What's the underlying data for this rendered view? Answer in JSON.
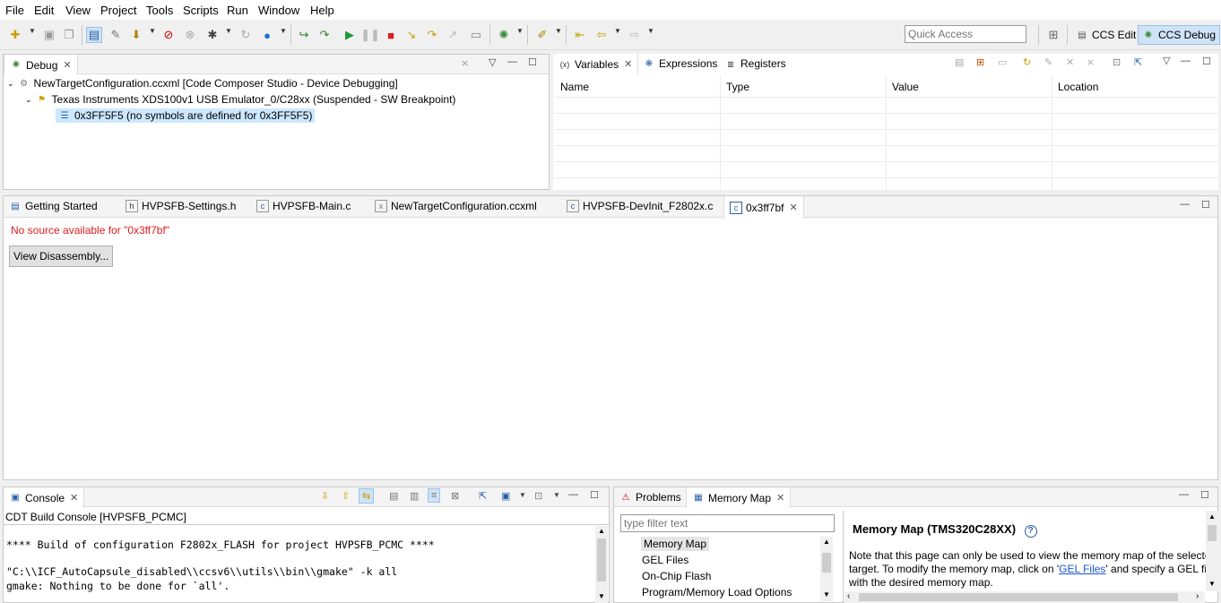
{
  "menu": [
    "File",
    "Edit",
    "View",
    "Project",
    "Tools",
    "Scripts",
    "Run",
    "Window",
    "Help"
  ],
  "toolbar": {
    "quick_access_placeholder": "Quick Access",
    "perspectives": [
      {
        "label": "CCS Edit",
        "active": false
      },
      {
        "label": "CCS Debug",
        "active": true
      }
    ]
  },
  "debug_view": {
    "tab_label": "Debug",
    "tree": [
      {
        "label": "NewTargetConfiguration.ccxml [Code Composer Studio - Device Debugging]",
        "level": 0
      },
      {
        "label": "Texas Instruments XDS100v1 USB Emulator_0/C28xx (Suspended - SW Breakpoint)",
        "level": 1
      },
      {
        "label": "0x3FF5F5  (no symbols are defined for 0x3FF5F5)",
        "level": 2,
        "selected": true
      }
    ]
  },
  "variables_view": {
    "tabs": [
      "Variables",
      "Expressions",
      "Registers"
    ],
    "columns": [
      "Name",
      "Type",
      "Value",
      "Location"
    ]
  },
  "editor": {
    "tabs": [
      {
        "label": "Getting Started"
      },
      {
        "label": "HVPSFB-Settings.h"
      },
      {
        "label": "HVPSFB-Main.c"
      },
      {
        "label": "NewTargetConfiguration.ccxml"
      },
      {
        "label": "HVPSFB-DevInit_F2802x.c"
      },
      {
        "label": "0x3ff7bf",
        "active": true
      }
    ],
    "message": "No source available for \"0x3ff7bf\"",
    "view_disassembly_label": "View Disassembly..."
  },
  "console": {
    "tab_label": "Console",
    "title": "CDT Build Console [HVPSFB_PCMC]",
    "lines": [
      "**** Build of configuration F2802x_FLASH for project HVPSFB_PCMC ****",
      "",
      "\"C:\\\\ICF_AutoCapsule_disabled\\\\ccsv6\\\\utils\\\\bin\\\\gmake\" -k all",
      "gmake: Nothing to be done for `all'."
    ]
  },
  "memory_map": {
    "tabs": [
      "Problems",
      "Memory Map"
    ],
    "filter_placeholder": "type filter text",
    "list": [
      "Memory Map",
      "GEL Files",
      "On-Chip Flash",
      "Program/Memory Load Options"
    ],
    "heading": "Memory Map (TMS320C28XX)",
    "help_icon_glyph": "?",
    "note_line1": "Note that this page can only be used to view the memory map of the selecte",
    "note_line2_pre": "target.  To modify the memory map, click on '",
    "note_link": "GEL Files",
    "note_line2_post": "' and specify a GEL file",
    "note_line3": "with the desired memory map."
  },
  "colors": {
    "error_text": "#e01b1b",
    "selection": "#cce8ff",
    "link": "#1a56c9"
  }
}
